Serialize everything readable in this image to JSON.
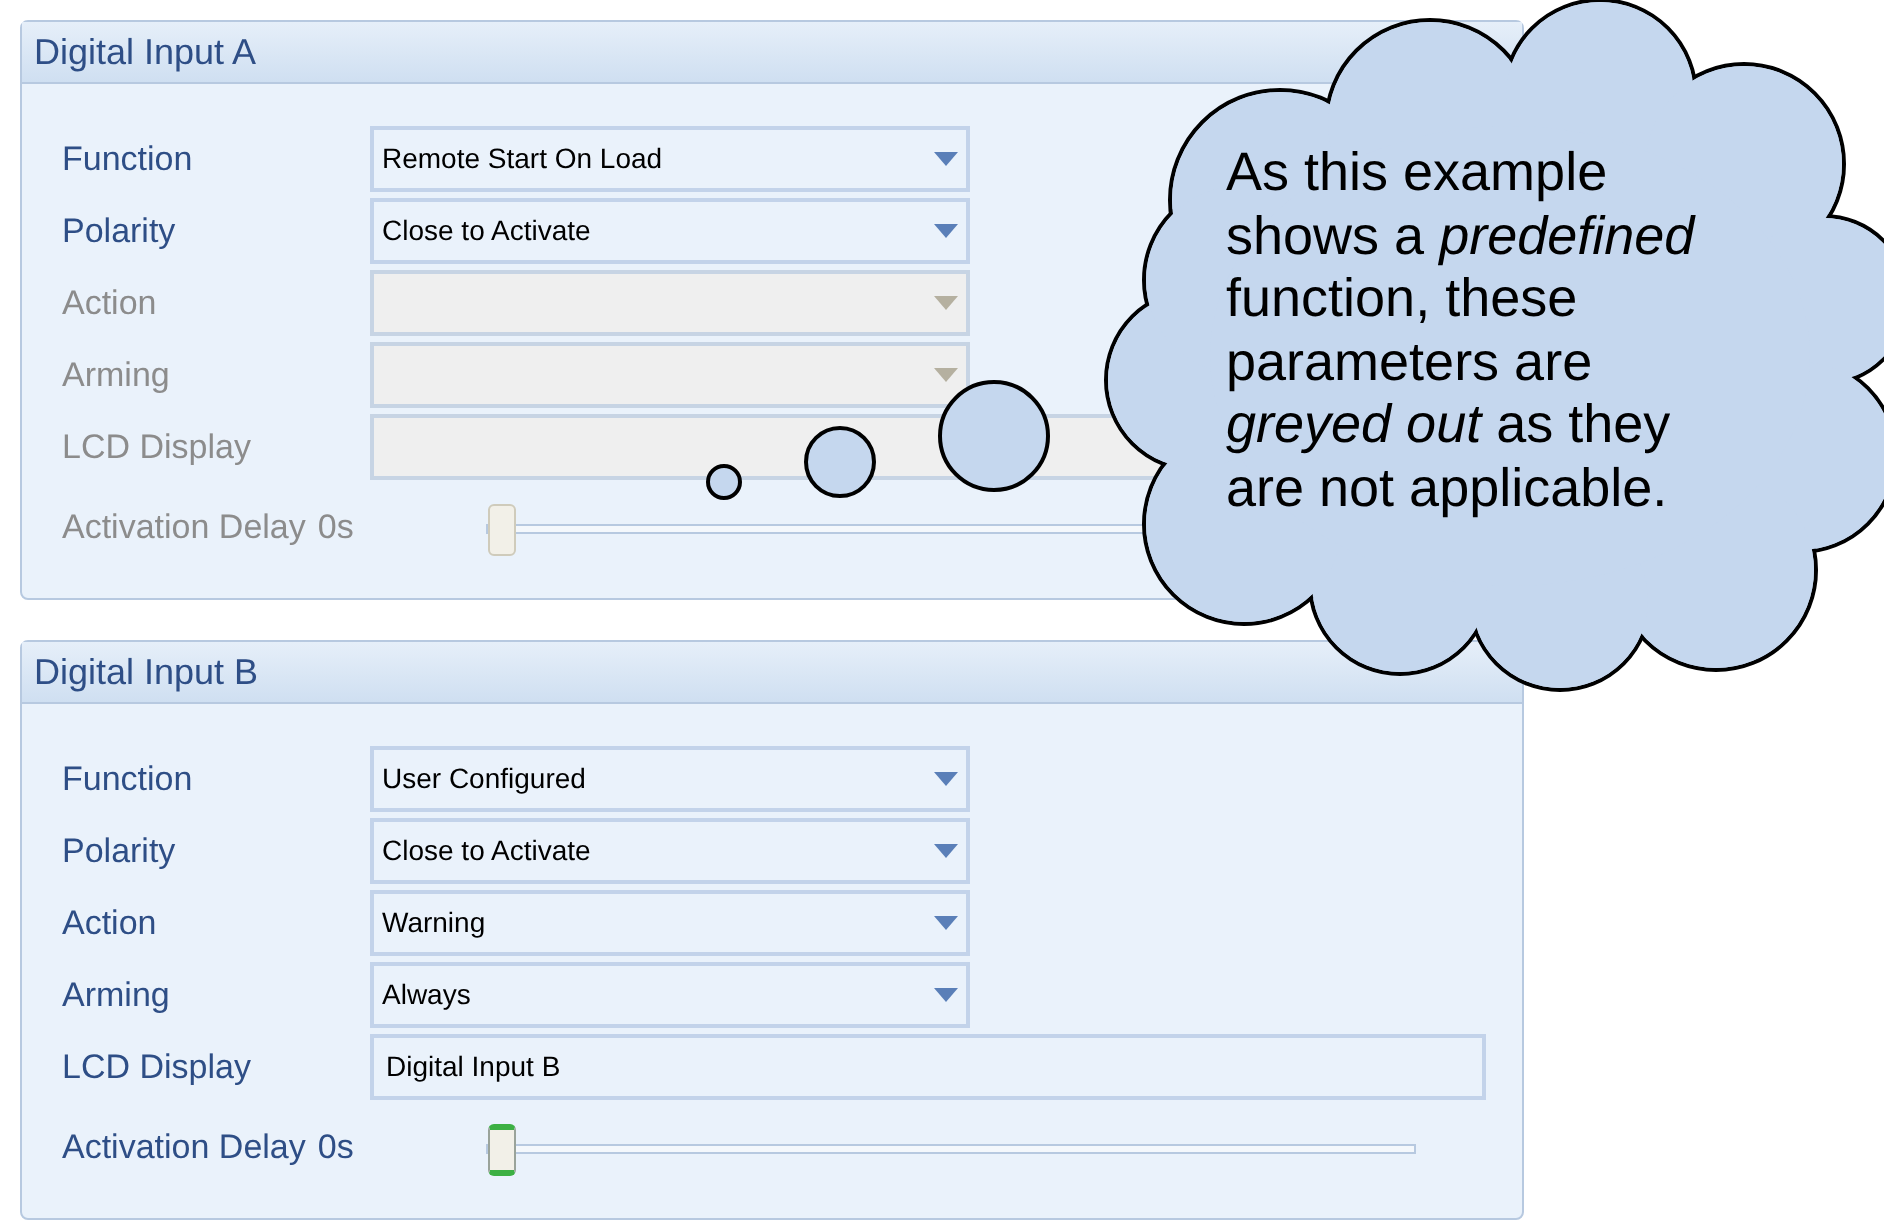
{
  "panels": [
    {
      "title": "Digital Input A",
      "fields": [
        {
          "kind": "dropdown",
          "label": "Function",
          "value": "Remote Start On Load",
          "disabled": false
        },
        {
          "kind": "dropdown",
          "label": "Polarity",
          "value": "Close to Activate",
          "disabled": false
        },
        {
          "kind": "dropdown",
          "label": "Action",
          "disabled": true
        },
        {
          "kind": "dropdown",
          "label": "Arming",
          "disabled": true
        },
        {
          "kind": "text",
          "label": "LCD Display",
          "disabled": true
        },
        {
          "kind": "slider",
          "label": "Activation Delay",
          "reading": "0s",
          "level": 0,
          "disabled": true
        }
      ]
    },
    {
      "title": "Digital Input B",
      "fields": [
        {
          "kind": "dropdown",
          "label": "Function",
          "value": "User Configured",
          "disabled": false
        },
        {
          "kind": "dropdown",
          "label": "Polarity",
          "value": "Close to Activate",
          "disabled": false
        },
        {
          "kind": "dropdown",
          "label": "Action",
          "value": "Warning",
          "disabled": false
        },
        {
          "kind": "dropdown",
          "label": "Arming",
          "value": "Always",
          "disabled": false
        },
        {
          "kind": "text",
          "label": "LCD Display",
          "value": "Digital Input B",
          "disabled": false
        },
        {
          "kind": "slider",
          "label": "Activation Delay",
          "reading": "0s",
          "level": 0,
          "disabled": false
        }
      ]
    }
  ],
  "callout": {
    "text": "As this example shows a *predefined* function, these parameters are *greyed out* as they are not applicable."
  }
}
